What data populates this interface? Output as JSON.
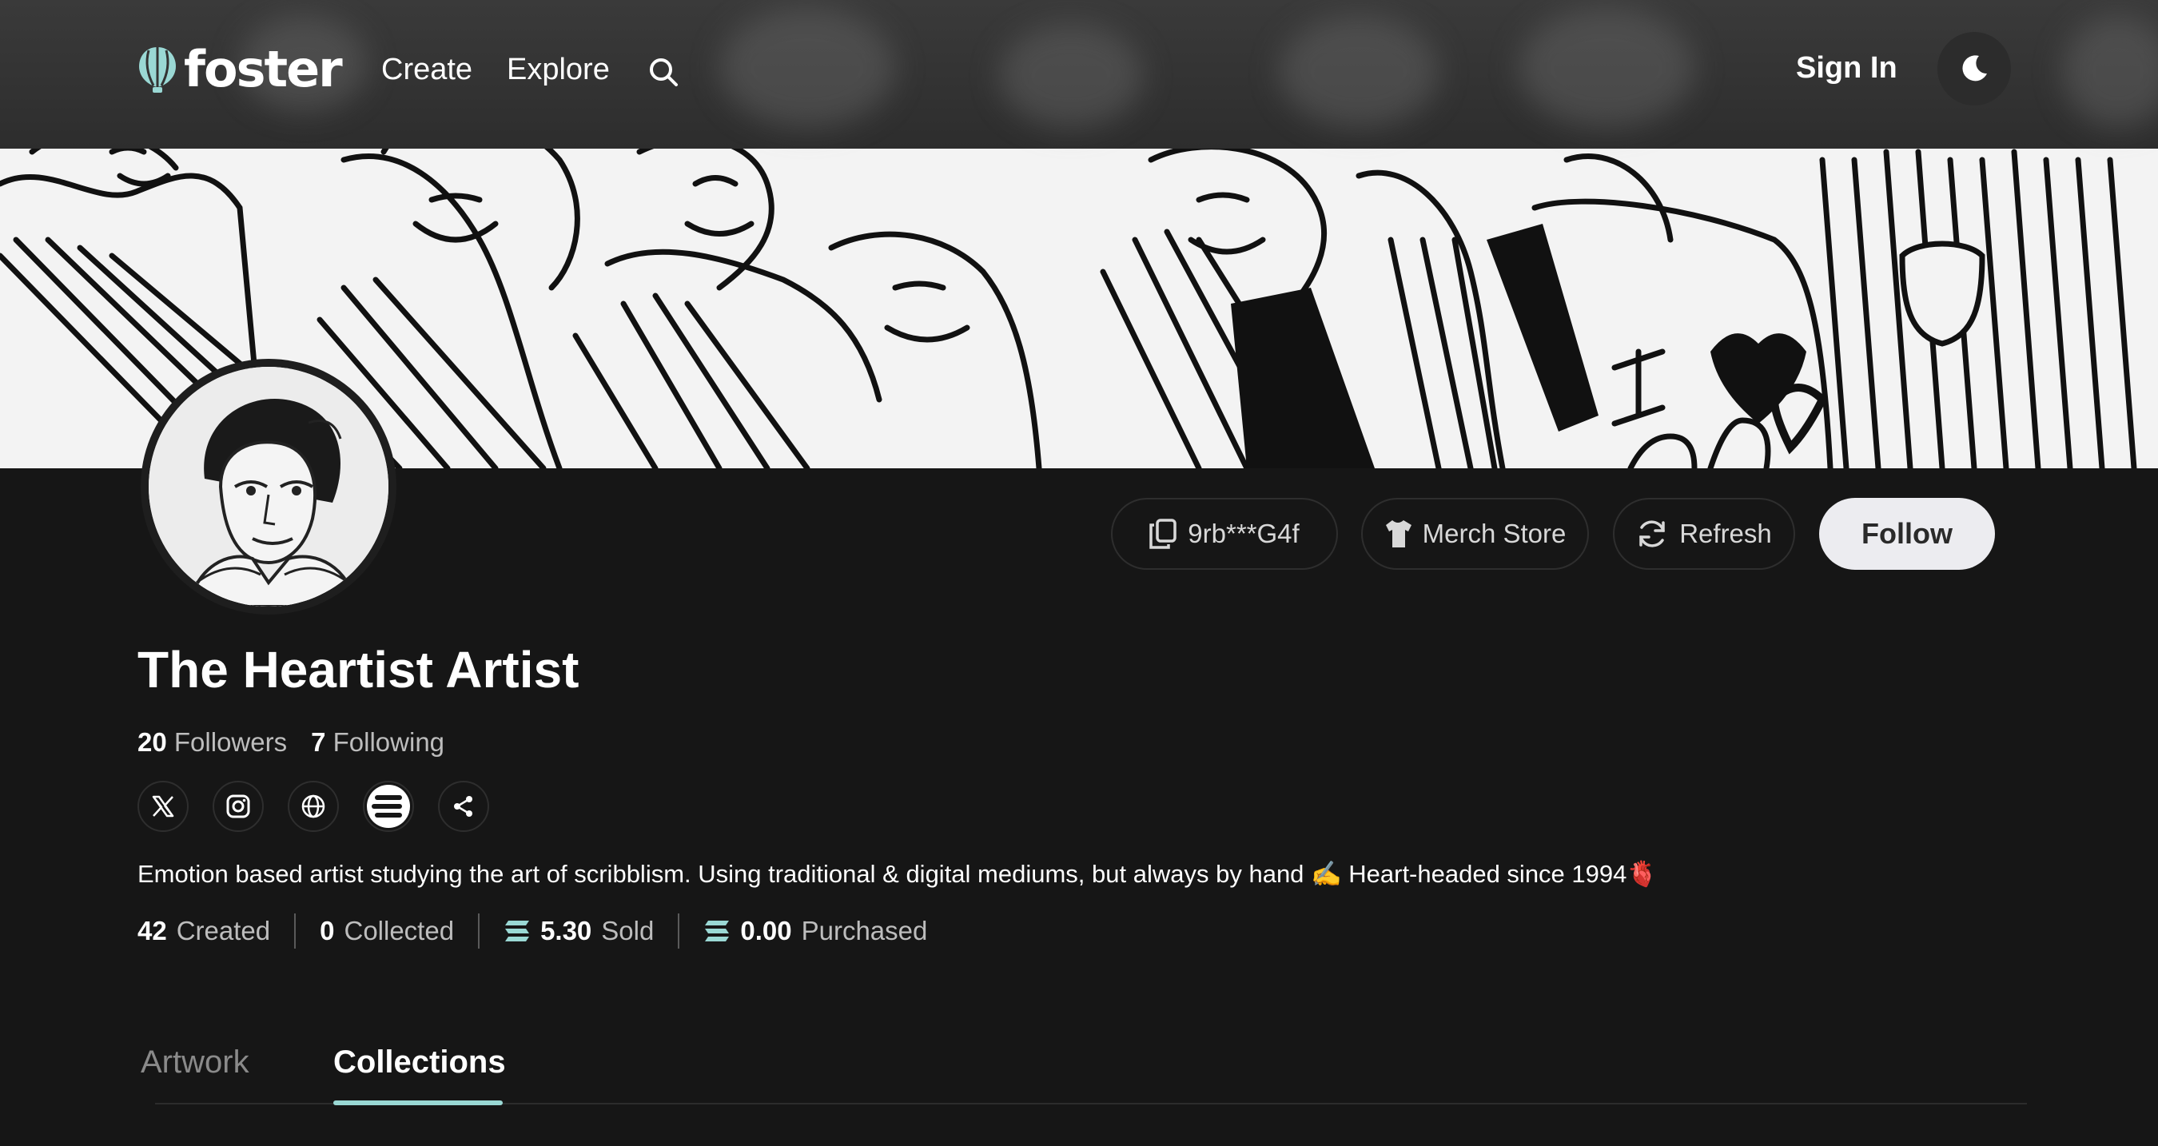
{
  "app": {
    "brand": "foster",
    "accent_color": "#9ad8d4",
    "background": "#161616"
  },
  "nav": {
    "links": [
      {
        "label": "Create"
      },
      {
        "label": "Explore"
      }
    ],
    "search_icon": "search-icon",
    "sign_in": "Sign In",
    "theme_icon": "moon-icon"
  },
  "profile": {
    "name": "The Heartist Artist",
    "followers_count": "20",
    "followers_label": "Followers",
    "following_count": "7",
    "following_label": "Following",
    "bio": "Emotion based artist studying the art of scribblism. Using traditional & digital mediums, but always by hand ✍️ Heart-headed since 1994🫀",
    "socials": [
      {
        "icon": "x-twitter-icon"
      },
      {
        "icon": "instagram-icon"
      },
      {
        "icon": "globe-icon"
      },
      {
        "icon": "foster-token-icon"
      },
      {
        "icon": "share-icon"
      }
    ]
  },
  "actions": {
    "address": "9rb***G4f",
    "merch": "Merch Store",
    "refresh": "Refresh",
    "follow": "Follow"
  },
  "metrics": [
    {
      "value": "42",
      "label": "Created"
    },
    {
      "value": "0",
      "label": "Collected"
    },
    {
      "value": "5.30",
      "label": "Sold",
      "icon": "sol-icon"
    },
    {
      "value": "0.00",
      "label": "Purchased",
      "icon": "sol-icon"
    }
  ],
  "tabs": [
    {
      "label": "Artwork",
      "active": false
    },
    {
      "label": "Collections",
      "active": true
    }
  ]
}
